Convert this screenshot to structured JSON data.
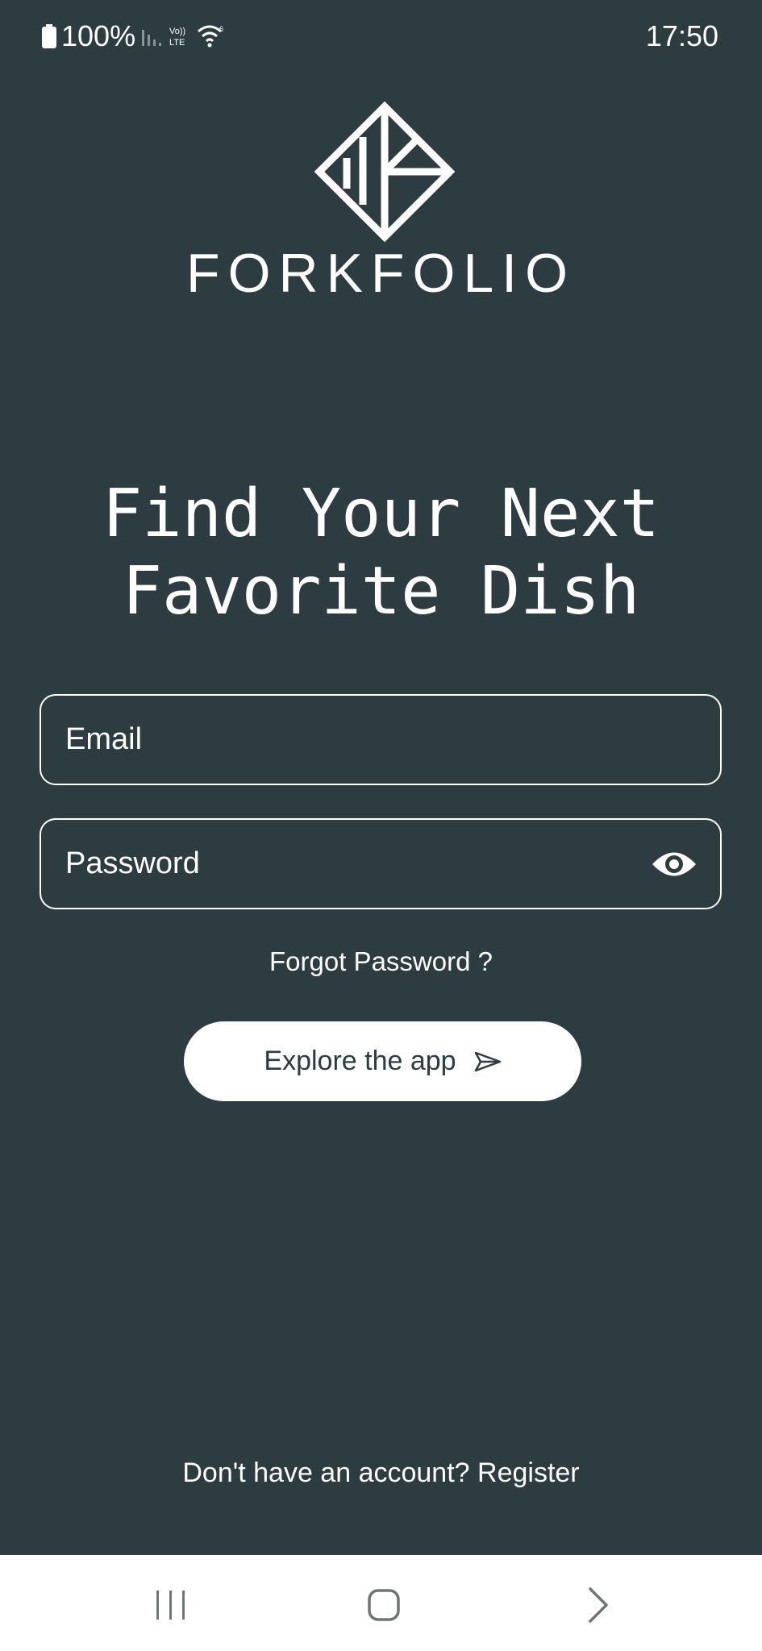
{
  "status_bar": {
    "battery": "100%",
    "time": "17:50",
    "icons": [
      "battery-icon",
      "signal-bars-icon",
      "volte-lte-icon",
      "wifi-6-icon"
    ]
  },
  "brand": {
    "name": "FORKFOLIO",
    "logo_icon": "diamond-fork-logo-icon"
  },
  "headline": {
    "line1": "Find Your Next",
    "line2": "Favorite Dish"
  },
  "form": {
    "email_placeholder": "Email",
    "password_placeholder": "Password",
    "password_toggle_icon": "eye-icon",
    "forgot_label": "Forgot Password ?",
    "cta_label": "Explore the app",
    "cta_icon": "send-icon"
  },
  "footer": {
    "prompt": "Don't have an account?",
    "register_label": "Register"
  },
  "nav_bar": {
    "icons": [
      "recents-icon",
      "home-icon",
      "back-icon"
    ]
  },
  "colors": {
    "background": "#2d3c40",
    "foreground": "#ffffff",
    "nav_background": "#ffffff",
    "nav_icons": "#6f7576"
  }
}
